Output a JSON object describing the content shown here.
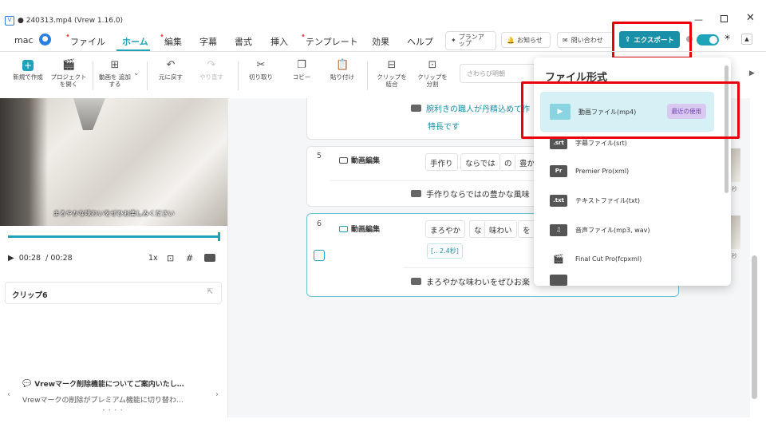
{
  "window": {
    "title": "● 240313.mp4 (Vrew 1.16.0)",
    "min_icon": "minimize-icon",
    "max_icon": "maximize-icon",
    "close_icon": "close-icon"
  },
  "menu": {
    "user": "mac",
    "tabs": [
      {
        "label": "ファイル",
        "dot": true
      },
      {
        "label": "ホーム",
        "active": true
      },
      {
        "label": "編集",
        "dot": true
      },
      {
        "label": "字幕"
      },
      {
        "label": "書式"
      },
      {
        "label": "挿入"
      },
      {
        "label": "テンプレート",
        "dot": true
      },
      {
        "label": "効果"
      },
      {
        "label": "ヘルプ"
      }
    ],
    "plan": "プランア ップ",
    "notice": "お知らせ",
    "contact": "問い合わせ",
    "export": "エクスポート"
  },
  "toolbar": {
    "new": "新規で作成",
    "open": "プロジェクト を開く",
    "add_video": "動画を 追加する",
    "undo": "元に戻す",
    "redo": "やり直す",
    "cut": "切り取り",
    "copy": "コピー",
    "paste": "貼り付け",
    "merge": "クリップを 結合",
    "split": "クリップを 分割",
    "search_placeholder": "さわらび明朝"
  },
  "preview": {
    "subtitle": "まろやかな味わいをぜひお楽しみください",
    "time_current": "00:28",
    "time_total": "/ 00:28",
    "speed": "1x",
    "progress": 1.0
  },
  "clip_panel": {
    "title": "クリップ6"
  },
  "announcement": {
    "title": "Vrewマーク削除機能についてご案内いたし…",
    "body": "Vrewマークの削除がプレミアム機能に切り替わ…"
  },
  "editor": {
    "prev_subtitle": [
      "腕利きの職人が丹精込めて作",
      "特長です"
    ],
    "clips": [
      {
        "num": "5",
        "label": "動画編集",
        "words": [
          "手作り",
          "ならでは",
          "の",
          "豊か"
        ],
        "subtitle": "手作りならではの豊かな風味"
      },
      {
        "num": "6",
        "label": "動画編集",
        "words": [
          "まろやか",
          "な",
          "味わい",
          "を"
        ],
        "pause": "[‥ 2.4秒]",
        "subtitle": "まろやかな味わいをぜひお楽"
      }
    ],
    "thumb_label": "秒"
  },
  "export_menu": {
    "title": "ファイル形式",
    "items": [
      {
        "icon": "▶",
        "label": "動画ファイル(mp4)",
        "badge": "最近の使用"
      },
      {
        "icon": ".srt",
        "label": "字幕ファイル(srt)"
      },
      {
        "icon": "Pr",
        "label": "Premier Pro(xml)"
      },
      {
        "icon": ".txt",
        "label": "テキストファイル(txt)"
      },
      {
        "icon": "♫",
        "label": "音声ファイル(mp3, wav)"
      },
      {
        "icon": "🎬",
        "label": "Final Cut Pro(fcpxml)"
      }
    ]
  },
  "colors": {
    "accent": "#1fa3b8",
    "export_bg": "#1a8fa8",
    "highlight": "#e8000a",
    "badge_bg": "#d9c9f0"
  }
}
